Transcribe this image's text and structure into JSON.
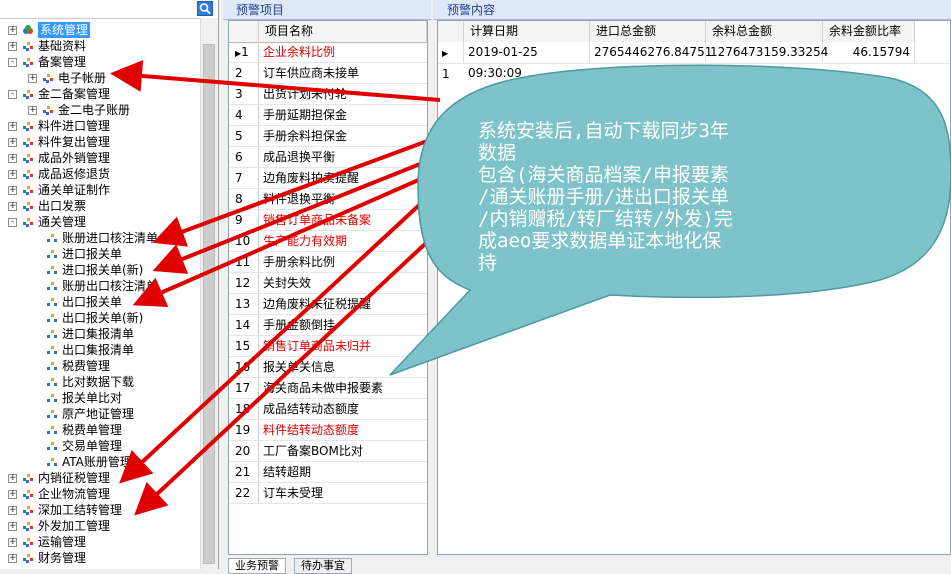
{
  "tree": {
    "items": [
      {
        "label": "系统管理",
        "level": 0,
        "expander": "+",
        "selected": true,
        "icon": "root-icon"
      },
      {
        "label": "基础资料",
        "level": 0,
        "expander": "+",
        "icon": "folder-icon"
      },
      {
        "label": "备案管理",
        "level": 0,
        "expander": "-",
        "icon": "folder-icon"
      },
      {
        "label": "电子帐册",
        "level": 1,
        "expander": "+",
        "icon": "folder-icon"
      },
      {
        "label": "金二备案管理",
        "level": 0,
        "expander": "-",
        "icon": "folder-icon"
      },
      {
        "label": "金二电子账册",
        "level": 1,
        "expander": "+",
        "icon": "folder-icon"
      },
      {
        "label": "料件进口管理",
        "level": 0,
        "expander": "+",
        "icon": "folder-icon"
      },
      {
        "label": "料件复出管理",
        "level": 0,
        "expander": "+",
        "icon": "folder-icon"
      },
      {
        "label": "成品外销管理",
        "level": 0,
        "expander": "+",
        "icon": "folder-icon"
      },
      {
        "label": "成品返修退货",
        "level": 0,
        "expander": "+",
        "icon": "folder-icon"
      },
      {
        "label": "通关单证制作",
        "level": 0,
        "expander": "+",
        "icon": "folder-icon"
      },
      {
        "label": "出口发票",
        "level": 0,
        "expander": "+",
        "icon": "folder-icon"
      },
      {
        "label": "通关管理",
        "level": 0,
        "expander": "-",
        "icon": "folder-icon"
      },
      {
        "label": "账册进口核注清单",
        "level": 2,
        "icon": "leaf-icon"
      },
      {
        "label": "进口报关单",
        "level": 2,
        "icon": "leaf-icon"
      },
      {
        "label": "进口报关单(新)",
        "level": 2,
        "icon": "leaf-icon"
      },
      {
        "label": "账册出口核注清单",
        "level": 2,
        "icon": "leaf-icon"
      },
      {
        "label": "出口报关单",
        "level": 2,
        "icon": "leaf-icon"
      },
      {
        "label": "出口报关单(新)",
        "level": 2,
        "icon": "leaf-icon"
      },
      {
        "label": "进口集报清单",
        "level": 2,
        "icon": "leaf-icon"
      },
      {
        "label": "出口集报清单",
        "level": 2,
        "icon": "leaf-icon"
      },
      {
        "label": "税费管理",
        "level": 2,
        "icon": "leaf-icon"
      },
      {
        "label": "比对数据下载",
        "level": 2,
        "icon": "leaf-icon"
      },
      {
        "label": "报关单比对",
        "level": 2,
        "icon": "leaf-icon"
      },
      {
        "label": "原产地证管理",
        "level": 2,
        "icon": "leaf-icon"
      },
      {
        "label": "税费单管理",
        "level": 2,
        "icon": "leaf-icon"
      },
      {
        "label": "交易单管理",
        "level": 2,
        "icon": "leaf-icon"
      },
      {
        "label": "ATA账册管理",
        "level": 2,
        "icon": "leaf-icon"
      },
      {
        "label": "内销征税管理",
        "level": 0,
        "expander": "+",
        "icon": "folder-icon"
      },
      {
        "label": "企业物流管理",
        "level": 0,
        "expander": "+",
        "icon": "folder-icon"
      },
      {
        "label": "深加工结转管理",
        "level": 0,
        "expander": "+",
        "icon": "folder-icon"
      },
      {
        "label": "外发加工管理",
        "level": 0,
        "expander": "+",
        "icon": "folder-icon"
      },
      {
        "label": "运输管理",
        "level": 0,
        "expander": "+",
        "icon": "folder-icon"
      },
      {
        "label": "财务管理",
        "level": 0,
        "expander": "+",
        "icon": "folder-icon"
      }
    ]
  },
  "warning_items": {
    "title": "预警项目",
    "header_name": "项目名称",
    "rows": [
      {
        "num": "1",
        "name": "企业余料比例",
        "red": true,
        "current": true
      },
      {
        "num": "2",
        "name": "订车供应商未接单"
      },
      {
        "num": "3",
        "name": "出货计划未付轮"
      },
      {
        "num": "4",
        "name": "手册延期担保金"
      },
      {
        "num": "5",
        "name": "手册余料担保金"
      },
      {
        "num": "6",
        "name": "成品退换平衡"
      },
      {
        "num": "7",
        "name": "边角废料拍卖提醒"
      },
      {
        "num": "8",
        "name": "料件退换平衡"
      },
      {
        "num": "9",
        "name": "销售订单商品未备案",
        "red": true
      },
      {
        "num": "10",
        "name": "生产能力有效期",
        "red": true
      },
      {
        "num": "11",
        "name": "手册余料比例"
      },
      {
        "num": "12",
        "name": "关封失效"
      },
      {
        "num": "13",
        "name": "边角废料未征税提醒"
      },
      {
        "num": "14",
        "name": "手册金额倒挂"
      },
      {
        "num": "15",
        "name": "销售订单商品未归并",
        "red": true
      },
      {
        "num": "16",
        "name": "报关单关信息"
      },
      {
        "num": "17",
        "name": "海关商品未做申报要素"
      },
      {
        "num": "18",
        "name": "成品结转动态额度"
      },
      {
        "num": "19",
        "name": "料件结转动态额度",
        "red": true
      },
      {
        "num": "20",
        "name": "工厂备案BOM比对"
      },
      {
        "num": "21",
        "name": "结转超期"
      },
      {
        "num": "22",
        "name": "订车未受理"
      }
    ],
    "tabs": [
      "业务预警",
      "待办事宜"
    ]
  },
  "warning_content": {
    "title": "预警内容",
    "headers": [
      "计算日期",
      "进口总金额",
      "余料总金额",
      "余料金额比率"
    ],
    "rows": [
      {
        "num": "1",
        "date": "2019-01-25 09:30:09",
        "import_total": "2765446276.84751",
        "surplus_total": "1276473159.33254",
        "ratio": "46.15794"
      }
    ]
  },
  "annotation": {
    "text": "系统安装后,自动下载同步3年\n数据\n 包含(海关商品档案/申报要素\n/通关账册手册/进出口报关单\n/内销赠税/转厂结转/外发)完\n成aeo要求数据单证本地化保\n持",
    "bubble_color": "#7ec3c9",
    "arrow_color": "#e00000"
  }
}
